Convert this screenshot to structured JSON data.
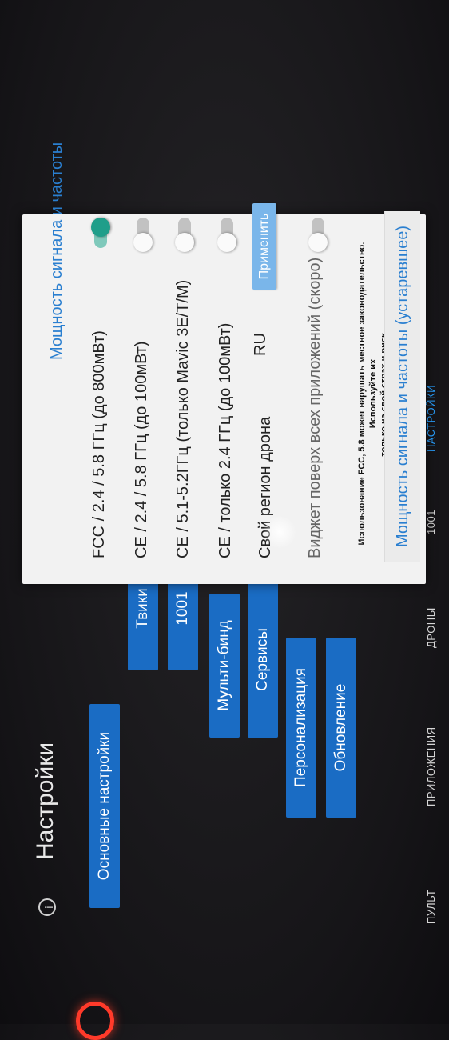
{
  "app": {
    "title": "Настройки"
  },
  "sidebar": {
    "items": [
      {
        "label": "Основные настройки"
      },
      {
        "label": "Твики"
      },
      {
        "label": "1001"
      },
      {
        "label": "Мульти-бинд"
      },
      {
        "label": "Сервисы"
      },
      {
        "label": "Персонализация"
      },
      {
        "label": "Обновление"
      }
    ]
  },
  "bottom_nav": {
    "items": [
      {
        "label": "ПУЛЬТ"
      },
      {
        "label": "ПРИЛОЖЕНИЯ"
      },
      {
        "label": "ДРОНЫ"
      },
      {
        "label": "1001"
      },
      {
        "label": "НАСТРОЙКИ"
      }
    ]
  },
  "dialog": {
    "header": "Мощность сигнала и частоты",
    "options": [
      {
        "label": "FCC / 2.4 / 5.8 ГГц (до 800мВт)",
        "enabled": true
      },
      {
        "label": "CE / 2.4 / 5.8 ГГц (до 100мВт)",
        "enabled": false
      },
      {
        "label": "CE / 5.1-5.2ГГц (только Mavic 3E/T/M)",
        "enabled": false
      },
      {
        "label": "CE / только 2.4 ГГц (до 100мВт)",
        "enabled": false
      }
    ],
    "region": {
      "label": "Свой регион дрона",
      "value": "RU",
      "apply_label": "Применить"
    },
    "widget": {
      "label": "Виджет поверх всех приложений (скоро)",
      "enabled": false
    },
    "warning_line1": "Использование FCC, 5.8 может нарушать местное законодательство. Используйте их",
    "warning_line2": "только на свой страх и риск.",
    "footer_link": "Мощность сигнала и частоты (устаревшее)"
  },
  "colors": {
    "accent": "#2a7fd0",
    "menu_bg": "#1a6cc4",
    "switch_on": "#1f9e8a",
    "apply_button": "#7ab6ea"
  }
}
